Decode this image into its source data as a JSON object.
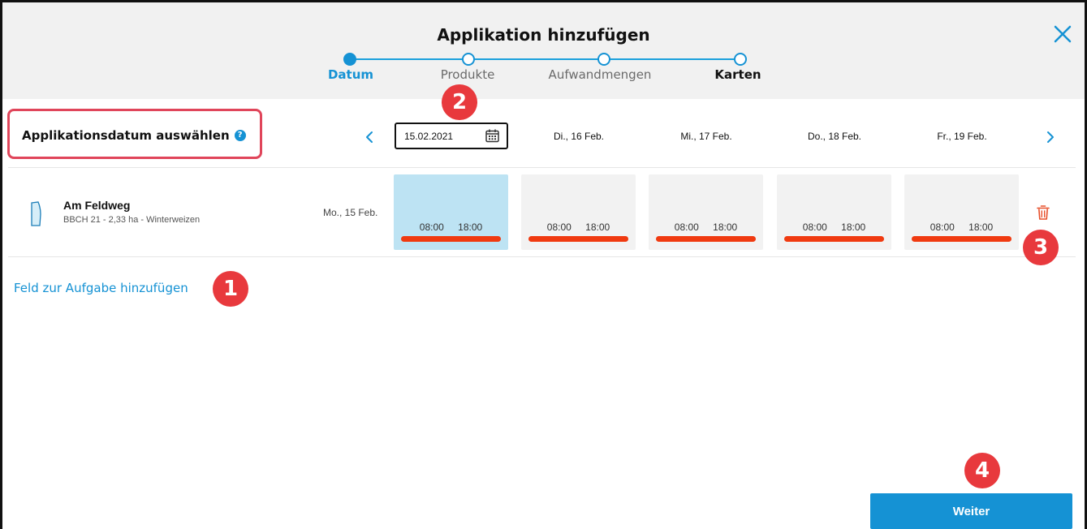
{
  "dialog": {
    "title": "Applikation hinzufügen"
  },
  "stepper": {
    "steps": [
      {
        "label": "Datum",
        "state": "active"
      },
      {
        "label": "Produkte",
        "state": "inactive"
      },
      {
        "label": "Aufwandmengen",
        "state": "inactive"
      },
      {
        "label": "Karten",
        "state": "inactive"
      }
    ]
  },
  "date_section": {
    "label": "Applikationsdatum auswählen",
    "help": "?",
    "date_input_value": "15.02.2021",
    "day_headers": [
      "Di., 16 Feb.",
      "Mi., 17 Feb.",
      "Do., 18 Feb.",
      "Fr., 19 Feb."
    ]
  },
  "field": {
    "name": "Am Feldweg",
    "details": "BBCH 21 - 2,33 ha - Winterweizen",
    "row_date": "Mo., 15 Feb.",
    "slots": [
      {
        "start": "08:00",
        "end": "18:00",
        "selected": true
      },
      {
        "start": "08:00",
        "end": "18:00",
        "selected": false
      },
      {
        "start": "08:00",
        "end": "18:00",
        "selected": false
      },
      {
        "start": "08:00",
        "end": "18:00",
        "selected": false
      },
      {
        "start": "08:00",
        "end": "18:00",
        "selected": false
      }
    ]
  },
  "add_field_link": "Feld zur Aufgabe hinzufügen",
  "next_button": "Weiter",
  "badges": [
    "1",
    "2",
    "3",
    "4"
  ],
  "colors": {
    "accent": "#1592d4",
    "selected_slot": "#bde3f3",
    "slot_bar": "#f03a10",
    "badge": "#e8393d",
    "highlight_border": "#e0455a"
  },
  "icons": [
    "close-icon",
    "help-icon",
    "chevron-left-icon",
    "calendar-icon",
    "chevron-right-icon",
    "field-shape-icon",
    "trash-icon"
  ]
}
